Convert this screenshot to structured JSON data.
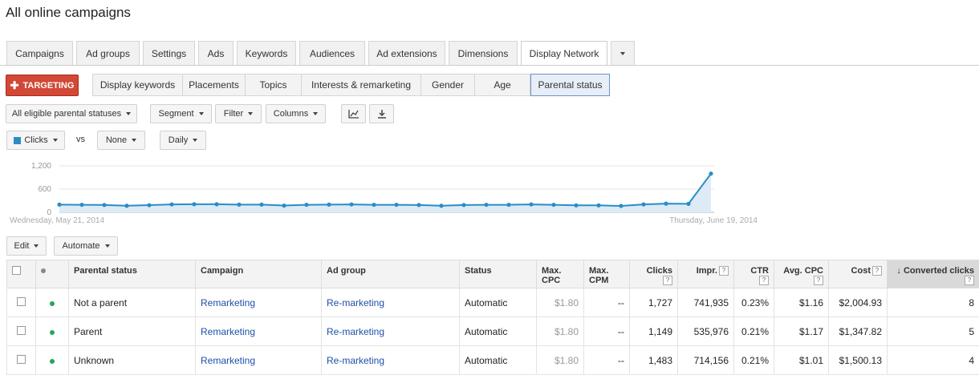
{
  "page_title": "All online campaigns",
  "tabs": [
    {
      "label": "Campaigns"
    },
    {
      "label": "Ad groups"
    },
    {
      "label": "Settings"
    },
    {
      "label": "Ads"
    },
    {
      "label": "Keywords"
    },
    {
      "label": "Audiences"
    },
    {
      "label": "Ad extensions"
    },
    {
      "label": "Dimensions"
    },
    {
      "label": "Display Network",
      "active": true
    }
  ],
  "targeting_button": "TARGETING",
  "subtabs": [
    {
      "label": "Display keywords"
    },
    {
      "label": "Placements"
    },
    {
      "label": "Topics"
    },
    {
      "label": "Interests & remarketing"
    },
    {
      "label": "Gender"
    },
    {
      "label": "Age"
    },
    {
      "label": "Parental status",
      "active": true
    }
  ],
  "toolbar": {
    "filter_status": "All eligible parental statuses",
    "segment": "Segment",
    "filter": "Filter",
    "columns": "Columns"
  },
  "chart_controls": {
    "metric1": "Clicks",
    "vs": "vs",
    "metric2": "None",
    "interval": "Daily"
  },
  "chart_data": {
    "type": "line",
    "series": [
      {
        "name": "Clicks",
        "values": [
          200,
          195,
          190,
          170,
          185,
          205,
          210,
          210,
          200,
          200,
          175,
          195,
          200,
          205,
          195,
          195,
          190,
          170,
          190,
          195,
          195,
          205,
          195,
          180,
          180,
          165,
          205,
          225,
          220,
          1000
        ]
      }
    ],
    "x": {
      "start_label": "Wednesday, May 21, 2014",
      "end_label": "Thursday, June 19, 2014"
    },
    "y_ticks": [
      "0",
      "600",
      "1,200"
    ],
    "ylim": [
      0,
      1200
    ],
    "color": "#2a8dc5"
  },
  "actions": {
    "edit": "Edit",
    "automate": "Automate"
  },
  "table": {
    "headers": {
      "parental_status": "Parental status",
      "campaign": "Campaign",
      "ad_group": "Ad group",
      "status": "Status",
      "max_cpc_1": "Max.",
      "max_cpc_2": "CPC",
      "max_cpm_1": "Max.",
      "max_cpm_2": "CPM",
      "clicks": "Clicks",
      "impr": "Impr.",
      "ctr": "CTR",
      "avg_cpc": "Avg. CPC",
      "cost": "Cost",
      "converted": "Converted clicks",
      "help": "?",
      "sort_arrow": "↓"
    },
    "rows": [
      {
        "status_label": "Not a parent",
        "campaign": "Remarketing",
        "ad_group": "Re-marketing",
        "status": "Automatic",
        "max_cpc": "$1.80",
        "max_cpm": "--",
        "clicks": "1,727",
        "impr": "741,935",
        "ctr": "0.23%",
        "avg_cpc": "$1.16",
        "cost": "$2,004.93",
        "converted": "8"
      },
      {
        "status_label": "Parent",
        "campaign": "Remarketing",
        "ad_group": "Re-marketing",
        "status": "Automatic",
        "max_cpc": "$1.80",
        "max_cpm": "--",
        "clicks": "1,149",
        "impr": "535,976",
        "ctr": "0.21%",
        "avg_cpc": "$1.17",
        "cost": "$1,347.82",
        "converted": "5"
      },
      {
        "status_label": "Unknown",
        "campaign": "Remarketing",
        "ad_group": "Re-marketing",
        "status": "Automatic",
        "max_cpc": "$1.80",
        "max_cpm": "--",
        "clicks": "1,483",
        "impr": "714,156",
        "ctr": "0.21%",
        "avg_cpc": "$1.01",
        "cost": "$1,500.13",
        "converted": "4"
      }
    ],
    "status_dot_color": "#27a55a"
  }
}
